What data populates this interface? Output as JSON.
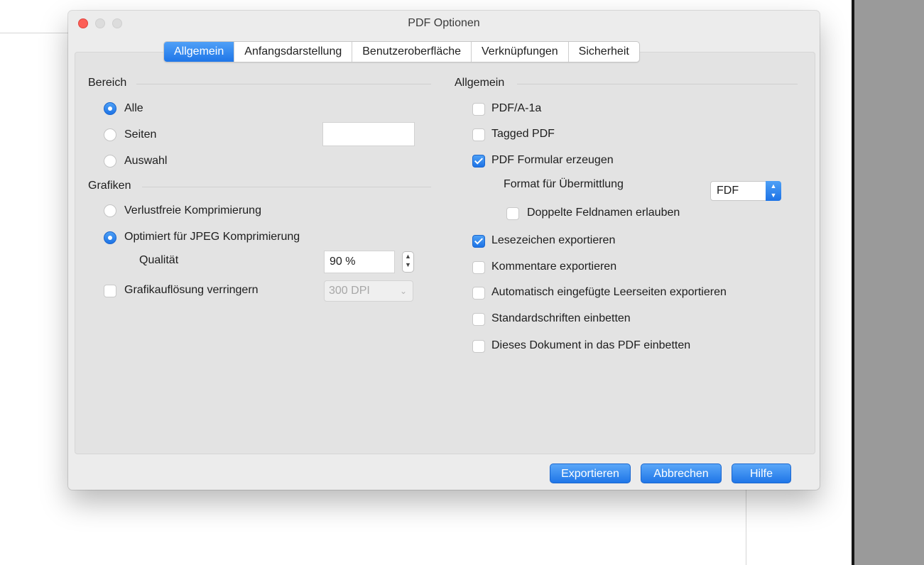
{
  "window": {
    "title": "PDF Optionen"
  },
  "tabs": [
    {
      "label": "Allgemein",
      "active": true
    },
    {
      "label": "Anfangsdarstellung",
      "active": false
    },
    {
      "label": "Benutzeroberfläche",
      "active": false
    },
    {
      "label": "Verknüpfungen",
      "active": false
    },
    {
      "label": "Sicherheit",
      "active": false
    }
  ],
  "left": {
    "bereich": {
      "heading": "Bereich",
      "alle": "Alle",
      "seiten": "Seiten",
      "seiten_value": "",
      "auswahl": "Auswahl",
      "selected": "Alle"
    },
    "grafiken": {
      "heading": "Grafiken",
      "lossless": "Verlustfreie Komprimierung",
      "jpeg": "Optimiert für JPEG Komprimierung",
      "selected": "Optimiert für JPEG Komprimierung",
      "quality_label": "Qualität",
      "quality_value": "90 %",
      "reduce_label": "Grafikauflösung verringern",
      "reduce_checked": false,
      "dpi_value": "300 DPI"
    }
  },
  "right": {
    "heading": "Allgemein",
    "pdfa": {
      "label": "PDF/A-1a",
      "checked": false
    },
    "tagged": {
      "label": "Tagged PDF",
      "checked": false
    },
    "form": {
      "label": "PDF Formular erzeugen",
      "checked": true
    },
    "submit_format_label": "Format für Übermittlung",
    "submit_format_value": "FDF",
    "duplicate": {
      "label": "Doppelte Feldnamen erlauben",
      "checked": false
    },
    "bookmarks": {
      "label": "Lesezeichen exportieren",
      "checked": true
    },
    "comments": {
      "label": "Kommentare exportieren",
      "checked": false
    },
    "blank_pages": {
      "label": "Automatisch eingefügte Leerseiten exportieren",
      "checked": false
    },
    "std_fonts": {
      "label": "Standardschriften einbetten",
      "checked": false
    },
    "embed_doc": {
      "label": "Dieses Dokument in das PDF einbetten",
      "checked": false
    }
  },
  "buttons": {
    "export": "Exportieren",
    "cancel": "Abbrechen",
    "help": "Hilfe"
  },
  "colors": {
    "accent": "#1f76e8",
    "close": "#fc5f57",
    "window_bg": "#ececec"
  }
}
